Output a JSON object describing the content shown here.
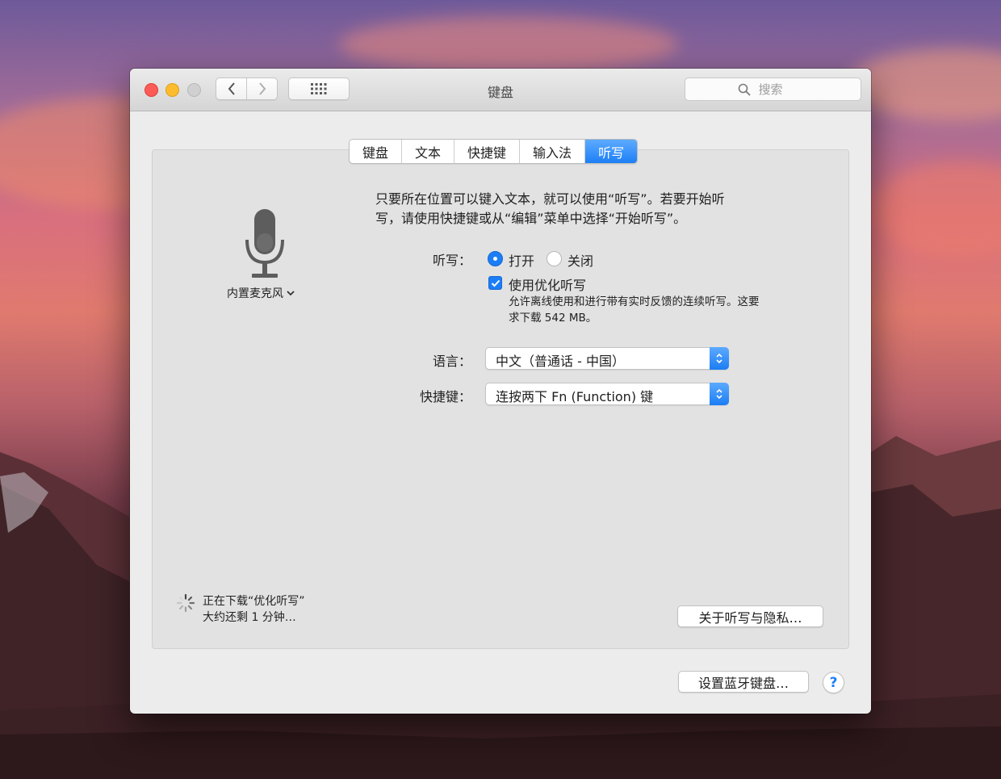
{
  "window": {
    "title": "键盘"
  },
  "search": {
    "placeholder": "搜索"
  },
  "tabs": [
    {
      "label": "键盘",
      "active": false
    },
    {
      "label": "文本",
      "active": false
    },
    {
      "label": "快捷键",
      "active": false
    },
    {
      "label": "输入法",
      "active": false
    },
    {
      "label": "听写",
      "active": true
    }
  ],
  "mic": {
    "source_label": "内置麦克风",
    "icon": "microphone-icon"
  },
  "description": {
    "line1": "只要所在位置可以键入文本，就可以使用“听写”。若要开始听",
    "line2": "写，请使用快捷键或从“编辑”菜单中选择“开始听写”。"
  },
  "dictation": {
    "label": "听写：",
    "option_on": "打开",
    "option_off": "关闭",
    "selected": "打开",
    "enhanced_label": "使用优化听写",
    "enhanced_checked": true,
    "enhanced_note_line1": "允许离线使用和进行带有实时反馈的连续听写。这要",
    "enhanced_note_line2": "求下载 542 MB。"
  },
  "language": {
    "label": "语言：",
    "value": "中文（普通话 - 中国）"
  },
  "shortcut": {
    "label": "快捷键：",
    "value": "连按两下 Fn (Function) 键"
  },
  "download_status": {
    "line1": "正在下载“优化听写”",
    "line2": "大约还剩 1 分钟…"
  },
  "buttons": {
    "privacy": "关于听写与隐私…",
    "bluetooth": "设置蓝牙键盘…",
    "help": "?"
  },
  "colors": {
    "accent": "#1c7ef6",
    "close": "#fc5b57",
    "minimize": "#fdbc2e",
    "zoom_disabled": "#d0d0d0"
  }
}
